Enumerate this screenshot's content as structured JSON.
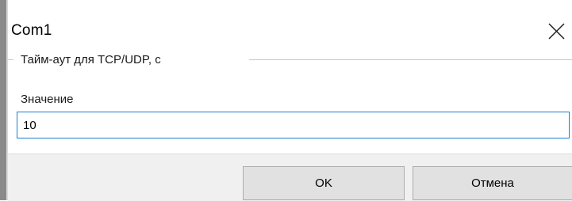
{
  "window": {
    "title": "Com1"
  },
  "group": {
    "title": "Тайм-аут для TCP/UDP, с"
  },
  "field": {
    "label": "Значение",
    "value": "10"
  },
  "buttons": {
    "ok_label": "OK",
    "cancel_label": "Отмена"
  },
  "colors": {
    "input_focus_border": "#1a7fd6",
    "button_face": "#e1e1e1",
    "dialog_background": "#f0f0f0"
  },
  "icons": {
    "close": "close-icon"
  }
}
